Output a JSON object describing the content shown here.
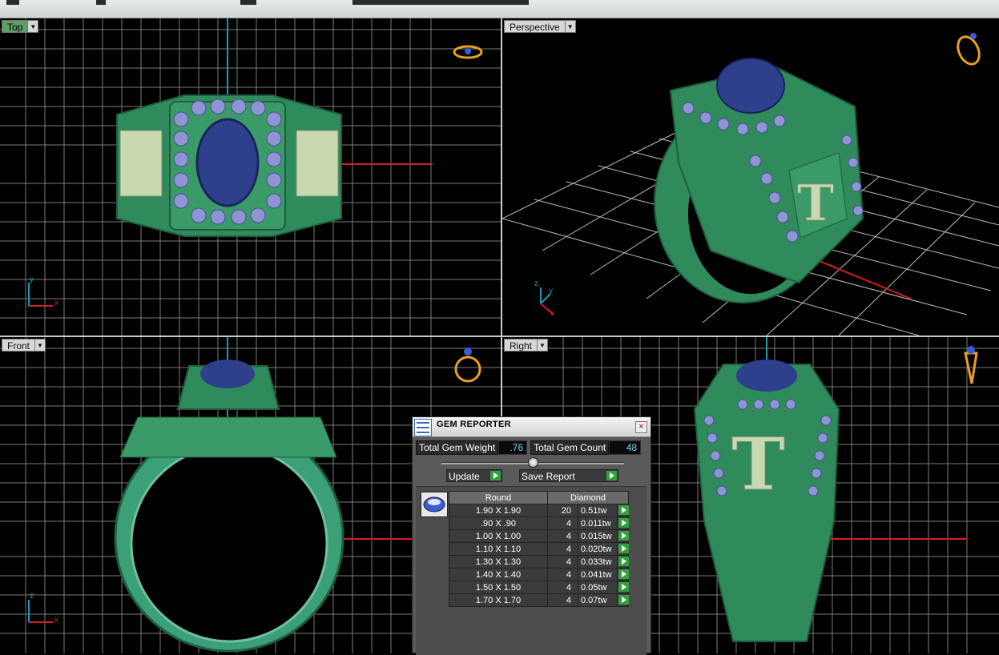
{
  "viewports": {
    "top": {
      "label": "Top",
      "axis_h": "x",
      "axis_v": "y"
    },
    "perspective": {
      "label": "Perspective",
      "axis_x": "x",
      "axis_y": "y",
      "axis_z": "z"
    },
    "front": {
      "label": "Front",
      "axis_h": "x",
      "axis_v": "z"
    },
    "right": {
      "label": "Right"
    }
  },
  "ring": {
    "letter": "T",
    "colors": {
      "metal": "#2f8a5c",
      "metal_dark": "#1f5e3e",
      "center_stone": "#2e3f8c",
      "side_stone": "#8f95d4",
      "letter": "#c8d8b0"
    }
  },
  "gem_reporter": {
    "title": "GEM REPORTER",
    "total_weight_label": "Total Gem Weight",
    "total_weight_value": ".76",
    "total_count_label": "Total Gem Count",
    "total_count_value": "48",
    "update_label": "Update",
    "save_label": "Save Report",
    "table": {
      "shape": "Round",
      "material": "Diamond",
      "rows": [
        {
          "size": "1.90 X 1.90",
          "count": "20",
          "weight": "0.51tw"
        },
        {
          "size": ".90 X .90",
          "count": "4",
          "weight": "0.011tw"
        },
        {
          "size": "1.00 X 1.00",
          "count": "4",
          "weight": "0.015tw"
        },
        {
          "size": "1.10 X 1.10",
          "count": "4",
          "weight": "0.020tw"
        },
        {
          "size": "1.30 X 1.30",
          "count": "4",
          "weight": "0.033tw"
        },
        {
          "size": "1.40 X 1.40",
          "count": "4",
          "weight": "0.041tw"
        },
        {
          "size": "1.50 X 1.50",
          "count": "4",
          "weight": "0.05tw"
        },
        {
          "size": "1.70 X 1.70",
          "count": "4",
          "weight": "0.07tw"
        }
      ]
    }
  },
  "colors": {
    "grid": "#7a7a7a",
    "x_axis": "#d42020",
    "y_axis": "#1a9bb0",
    "active_label": "#5e9d6a",
    "go_button": "#2ea43a",
    "field_value": "#7cd6f0"
  }
}
